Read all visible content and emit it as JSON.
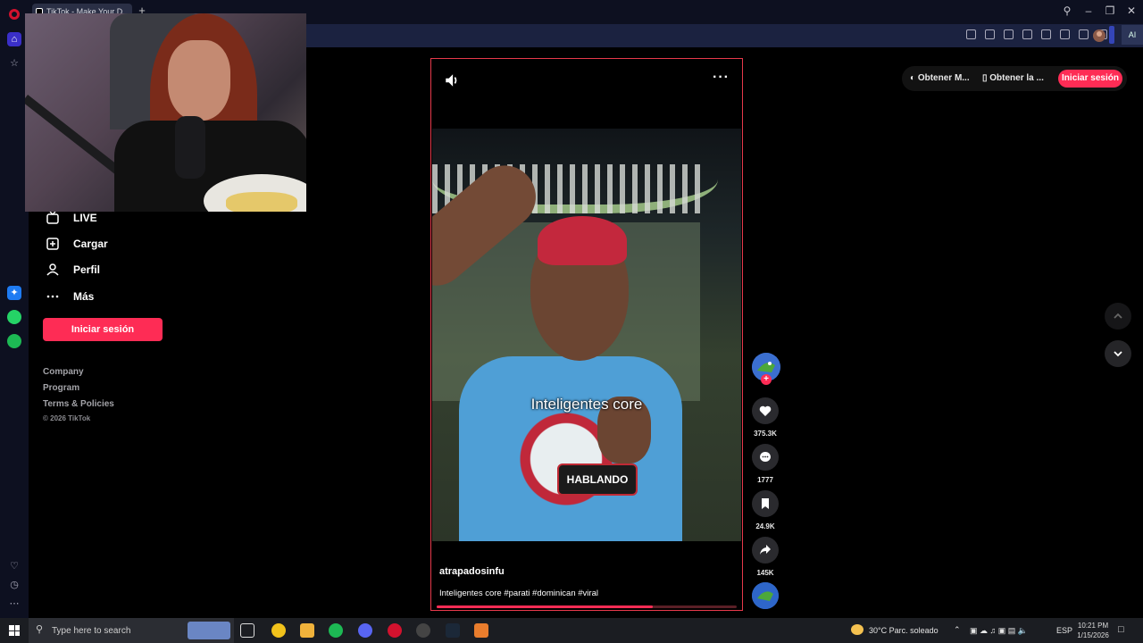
{
  "browser": {
    "tab_title": "TikTok - Make Your D",
    "new_tab": "+",
    "ai_label": "AI"
  },
  "sidebar": {
    "items": [
      {
        "label": "LIVE",
        "icon": "live-icon"
      },
      {
        "label": "Cargar",
        "icon": "upload-icon"
      },
      {
        "label": "Perfil",
        "icon": "profile-icon"
      },
      {
        "label": "Más",
        "icon": "more-icon"
      }
    ],
    "login_label": "Iniciar sesión",
    "footer": [
      "Company",
      "Program",
      "Terms & Policies"
    ],
    "copyright": "© 2026 TikTok"
  },
  "video": {
    "caption_overlay": "Inteligentes core",
    "logo_text": "HABLANDO",
    "author": "atrapadosinfu",
    "description": "Inteligentes core #parati #dominican #viral",
    "progress": 0.72
  },
  "actions": {
    "likes": "375.3K",
    "comments": "1777",
    "saves": "24.9K",
    "shares": "145K"
  },
  "topbar": {
    "get_app_1": "Obtener M...",
    "get_app_2": "Obtener la ...",
    "login_label": "Iniciar sesión"
  },
  "taskbar": {
    "search_placeholder": "Type here to search",
    "weather": "30°C  Parc. soleado",
    "language": "ESP",
    "time": "10:21 PM",
    "date": "1/15/2026"
  },
  "colors": {
    "accent": "#fe2c55",
    "player_border": "#e6394b",
    "chrome_bg": "#0d1020"
  }
}
